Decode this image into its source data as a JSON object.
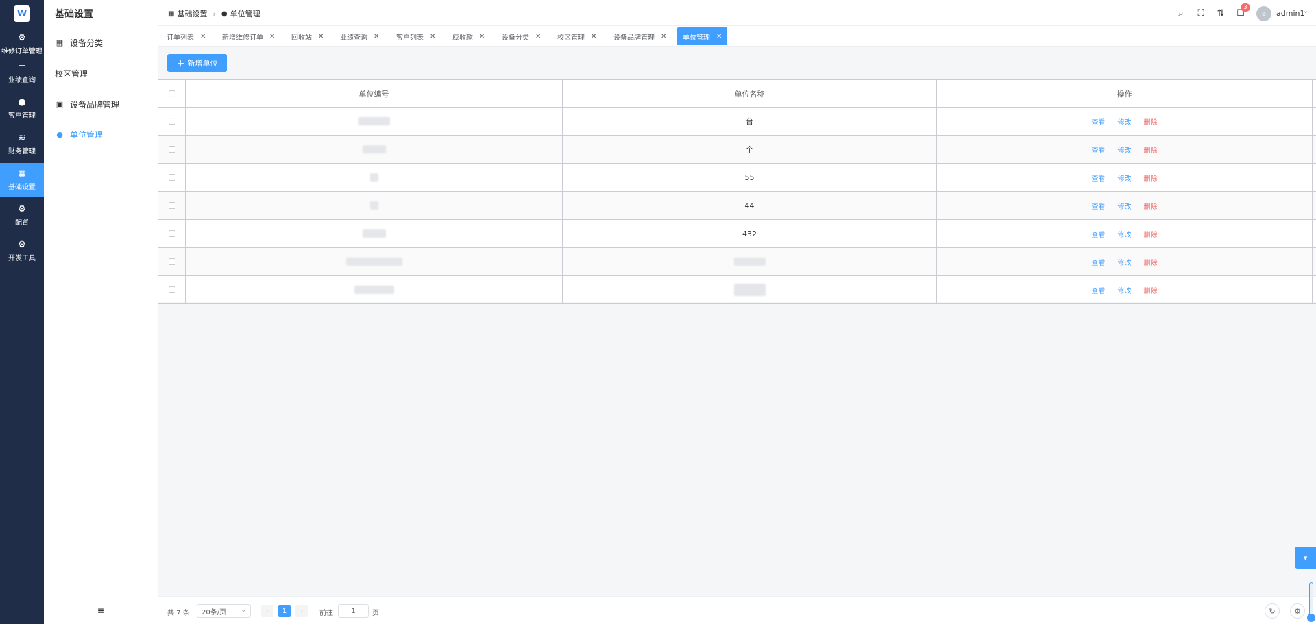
{
  "rail": {
    "items": [
      {
        "label": "维修订单管理",
        "icon": "chip-icon"
      },
      {
        "label": "业绩查询",
        "icon": "presentation-icon"
      },
      {
        "label": "客户管理",
        "icon": "user-icon"
      },
      {
        "label": "财务管理",
        "icon": "database-icon"
      },
      {
        "label": "基础设置",
        "icon": "grid-icon"
      },
      {
        "label": "配置",
        "icon": "gear-icon"
      },
      {
        "label": "开发工具",
        "icon": "gear-icon"
      }
    ]
  },
  "sidebar": {
    "title": "基础设置",
    "items": [
      {
        "label": "设备分类"
      },
      {
        "label": "校区管理"
      },
      {
        "label": "设备品牌管理"
      },
      {
        "label": "单位管理"
      }
    ]
  },
  "breadcrumb": {
    "parent": "基础设置",
    "current": "单位管理"
  },
  "header": {
    "badge_count": "3",
    "avatar_letter": "a",
    "username": "admin1"
  },
  "tabs": [
    {
      "label": "订单列表"
    },
    {
      "label": "新增维修订单"
    },
    {
      "label": "回收站"
    },
    {
      "label": "业绩查询"
    },
    {
      "label": "客户列表"
    },
    {
      "label": "应收款"
    },
    {
      "label": "设备分类"
    },
    {
      "label": "校区管理"
    },
    {
      "label": "设备品牌管理"
    },
    {
      "label": "单位管理"
    }
  ],
  "toolbar": {
    "add_label": "新增单位"
  },
  "table": {
    "columns": [
      "单位编号",
      "单位名称",
      "操作"
    ],
    "actions": {
      "view": "查看",
      "edit": "修改",
      "delete": "删除"
    },
    "rows": [
      {
        "name": "台"
      },
      {
        "name": "个"
      },
      {
        "name": "55"
      },
      {
        "name": "44"
      },
      {
        "name": "432"
      },
      {
        "name": ""
      },
      {
        "name": ""
      }
    ]
  },
  "pagination": {
    "total": "共 7 条",
    "page_size": "20条/页",
    "current_page": "1",
    "goto_label": "前往",
    "goto_value": "1",
    "page_unit": "页"
  },
  "colors": {
    "primary": "#409eff",
    "danger": "#f56c6c",
    "rail_bg": "#1f2d48"
  }
}
